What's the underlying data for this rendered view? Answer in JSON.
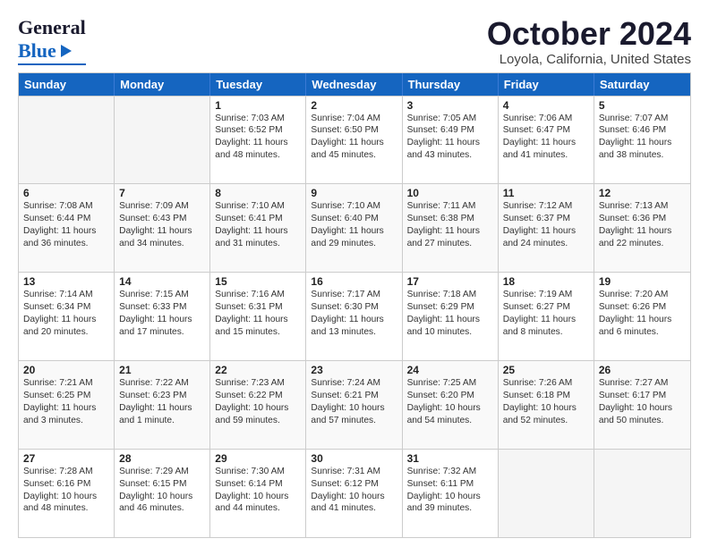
{
  "header": {
    "logo_line1": "General",
    "logo_line2": "Blue",
    "month": "October 2024",
    "location": "Loyola, California, United States"
  },
  "weekdays": [
    "Sunday",
    "Monday",
    "Tuesday",
    "Wednesday",
    "Thursday",
    "Friday",
    "Saturday"
  ],
  "rows": [
    [
      {
        "day": "",
        "sunrise": "",
        "sunset": "",
        "daylight": "",
        "empty": true
      },
      {
        "day": "",
        "sunrise": "",
        "sunset": "",
        "daylight": "",
        "empty": true
      },
      {
        "day": "1",
        "sunrise": "Sunrise: 7:03 AM",
        "sunset": "Sunset: 6:52 PM",
        "daylight": "Daylight: 11 hours and 48 minutes."
      },
      {
        "day": "2",
        "sunrise": "Sunrise: 7:04 AM",
        "sunset": "Sunset: 6:50 PM",
        "daylight": "Daylight: 11 hours and 45 minutes."
      },
      {
        "day": "3",
        "sunrise": "Sunrise: 7:05 AM",
        "sunset": "Sunset: 6:49 PM",
        "daylight": "Daylight: 11 hours and 43 minutes."
      },
      {
        "day": "4",
        "sunrise": "Sunrise: 7:06 AM",
        "sunset": "Sunset: 6:47 PM",
        "daylight": "Daylight: 11 hours and 41 minutes."
      },
      {
        "day": "5",
        "sunrise": "Sunrise: 7:07 AM",
        "sunset": "Sunset: 6:46 PM",
        "daylight": "Daylight: 11 hours and 38 minutes."
      }
    ],
    [
      {
        "day": "6",
        "sunrise": "Sunrise: 7:08 AM",
        "sunset": "Sunset: 6:44 PM",
        "daylight": "Daylight: 11 hours and 36 minutes."
      },
      {
        "day": "7",
        "sunrise": "Sunrise: 7:09 AM",
        "sunset": "Sunset: 6:43 PM",
        "daylight": "Daylight: 11 hours and 34 minutes."
      },
      {
        "day": "8",
        "sunrise": "Sunrise: 7:10 AM",
        "sunset": "Sunset: 6:41 PM",
        "daylight": "Daylight: 11 hours and 31 minutes."
      },
      {
        "day": "9",
        "sunrise": "Sunrise: 7:10 AM",
        "sunset": "Sunset: 6:40 PM",
        "daylight": "Daylight: 11 hours and 29 minutes."
      },
      {
        "day": "10",
        "sunrise": "Sunrise: 7:11 AM",
        "sunset": "Sunset: 6:38 PM",
        "daylight": "Daylight: 11 hours and 27 minutes."
      },
      {
        "day": "11",
        "sunrise": "Sunrise: 7:12 AM",
        "sunset": "Sunset: 6:37 PM",
        "daylight": "Daylight: 11 hours and 24 minutes."
      },
      {
        "day": "12",
        "sunrise": "Sunrise: 7:13 AM",
        "sunset": "Sunset: 6:36 PM",
        "daylight": "Daylight: 11 hours and 22 minutes."
      }
    ],
    [
      {
        "day": "13",
        "sunrise": "Sunrise: 7:14 AM",
        "sunset": "Sunset: 6:34 PM",
        "daylight": "Daylight: 11 hours and 20 minutes."
      },
      {
        "day": "14",
        "sunrise": "Sunrise: 7:15 AM",
        "sunset": "Sunset: 6:33 PM",
        "daylight": "Daylight: 11 hours and 17 minutes."
      },
      {
        "day": "15",
        "sunrise": "Sunrise: 7:16 AM",
        "sunset": "Sunset: 6:31 PM",
        "daylight": "Daylight: 11 hours and 15 minutes."
      },
      {
        "day": "16",
        "sunrise": "Sunrise: 7:17 AM",
        "sunset": "Sunset: 6:30 PM",
        "daylight": "Daylight: 11 hours and 13 minutes."
      },
      {
        "day": "17",
        "sunrise": "Sunrise: 7:18 AM",
        "sunset": "Sunset: 6:29 PM",
        "daylight": "Daylight: 11 hours and 10 minutes."
      },
      {
        "day": "18",
        "sunrise": "Sunrise: 7:19 AM",
        "sunset": "Sunset: 6:27 PM",
        "daylight": "Daylight: 11 hours and 8 minutes."
      },
      {
        "day": "19",
        "sunrise": "Sunrise: 7:20 AM",
        "sunset": "Sunset: 6:26 PM",
        "daylight": "Daylight: 11 hours and 6 minutes."
      }
    ],
    [
      {
        "day": "20",
        "sunrise": "Sunrise: 7:21 AM",
        "sunset": "Sunset: 6:25 PM",
        "daylight": "Daylight: 11 hours and 3 minutes."
      },
      {
        "day": "21",
        "sunrise": "Sunrise: 7:22 AM",
        "sunset": "Sunset: 6:23 PM",
        "daylight": "Daylight: 11 hours and 1 minute."
      },
      {
        "day": "22",
        "sunrise": "Sunrise: 7:23 AM",
        "sunset": "Sunset: 6:22 PM",
        "daylight": "Daylight: 10 hours and 59 minutes."
      },
      {
        "day": "23",
        "sunrise": "Sunrise: 7:24 AM",
        "sunset": "Sunset: 6:21 PM",
        "daylight": "Daylight: 10 hours and 57 minutes."
      },
      {
        "day": "24",
        "sunrise": "Sunrise: 7:25 AM",
        "sunset": "Sunset: 6:20 PM",
        "daylight": "Daylight: 10 hours and 54 minutes."
      },
      {
        "day": "25",
        "sunrise": "Sunrise: 7:26 AM",
        "sunset": "Sunset: 6:18 PM",
        "daylight": "Daylight: 10 hours and 52 minutes."
      },
      {
        "day": "26",
        "sunrise": "Sunrise: 7:27 AM",
        "sunset": "Sunset: 6:17 PM",
        "daylight": "Daylight: 10 hours and 50 minutes."
      }
    ],
    [
      {
        "day": "27",
        "sunrise": "Sunrise: 7:28 AM",
        "sunset": "Sunset: 6:16 PM",
        "daylight": "Daylight: 10 hours and 48 minutes."
      },
      {
        "day": "28",
        "sunrise": "Sunrise: 7:29 AM",
        "sunset": "Sunset: 6:15 PM",
        "daylight": "Daylight: 10 hours and 46 minutes."
      },
      {
        "day": "29",
        "sunrise": "Sunrise: 7:30 AM",
        "sunset": "Sunset: 6:14 PM",
        "daylight": "Daylight: 10 hours and 44 minutes."
      },
      {
        "day": "30",
        "sunrise": "Sunrise: 7:31 AM",
        "sunset": "Sunset: 6:12 PM",
        "daylight": "Daylight: 10 hours and 41 minutes."
      },
      {
        "day": "31",
        "sunrise": "Sunrise: 7:32 AM",
        "sunset": "Sunset: 6:11 PM",
        "daylight": "Daylight: 10 hours and 39 minutes."
      },
      {
        "day": "",
        "sunrise": "",
        "sunset": "",
        "daylight": "",
        "empty": true
      },
      {
        "day": "",
        "sunrise": "",
        "sunset": "",
        "daylight": "",
        "empty": true
      }
    ]
  ]
}
